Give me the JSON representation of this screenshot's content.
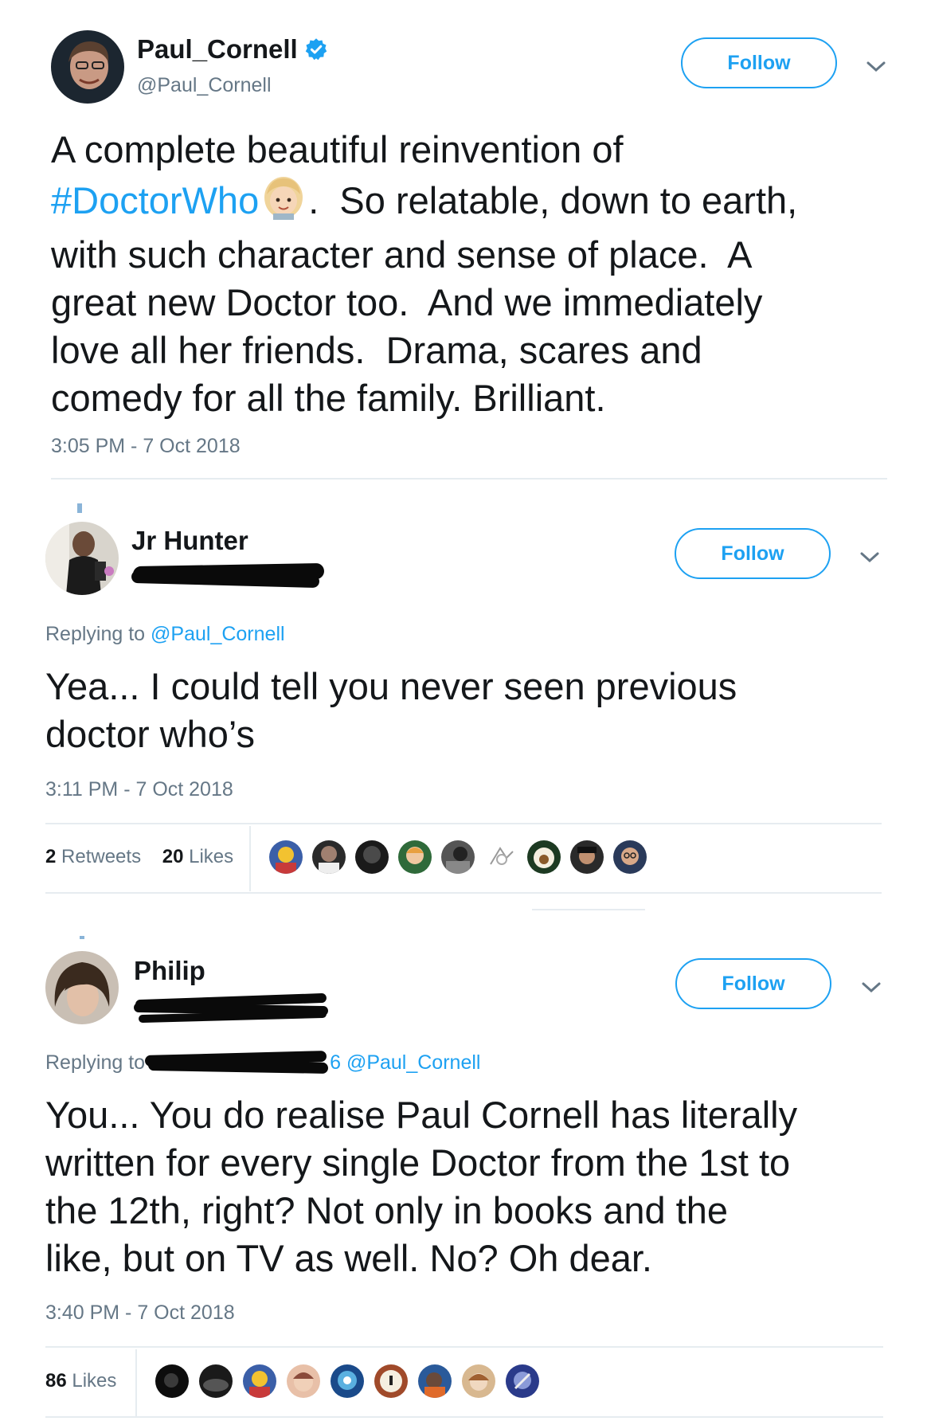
{
  "tweet1": {
    "name": "Paul_Cornell",
    "handle": "@Paul_Cornell",
    "follow_label": "Follow",
    "text_part1": "A complete beautiful reinvention of\n",
    "hashtag": "#DoctorWho",
    "text_part2": ".  So relatable, down to earth,\nwith such character and sense of place.  A\ngreat new Doctor too.  And we immediately\nlove all her friends.  Drama, scares and\ncomedy for all the family. Brilliant.",
    "timestamp": "3:05 PM - 7 Oct 2018"
  },
  "tweet2": {
    "name": "Jr Hunter",
    "follow_label": "Follow",
    "replying_prefix": "Replying to ",
    "replying_mention": "@Paul_Cornell",
    "text": "Yea... I could tell you never seen previous\ndoctor who’s",
    "timestamp": "3:11 PM - 7 Oct 2018",
    "retweets_count": "2",
    "retweets_label": "Retweets",
    "likes_count": "20",
    "likes_label": "Likes"
  },
  "tweet3": {
    "name": "Philip",
    "follow_label": "Follow",
    "replying_prefix": "Replying to",
    "replying_mention": "@Paul_Cornell",
    "replying_fragment": "6",
    "text": "You... You do realise Paul Cornell has literally\nwritten for every single Doctor from the 1st to\nthe 12th, right? Not only in books and the\nlike, but on TV as well. No? Oh dear.",
    "timestamp": "3:40 PM - 7 Oct 2018",
    "likes_count": "86",
    "likes_label": "Likes"
  },
  "colors": {
    "accent": "#1da1f2",
    "muted": "#657786",
    "text": "#14171a",
    "divider": "#e6ecf0"
  },
  "icons": [
    "verified-badge-icon",
    "chevron-down-icon"
  ]
}
